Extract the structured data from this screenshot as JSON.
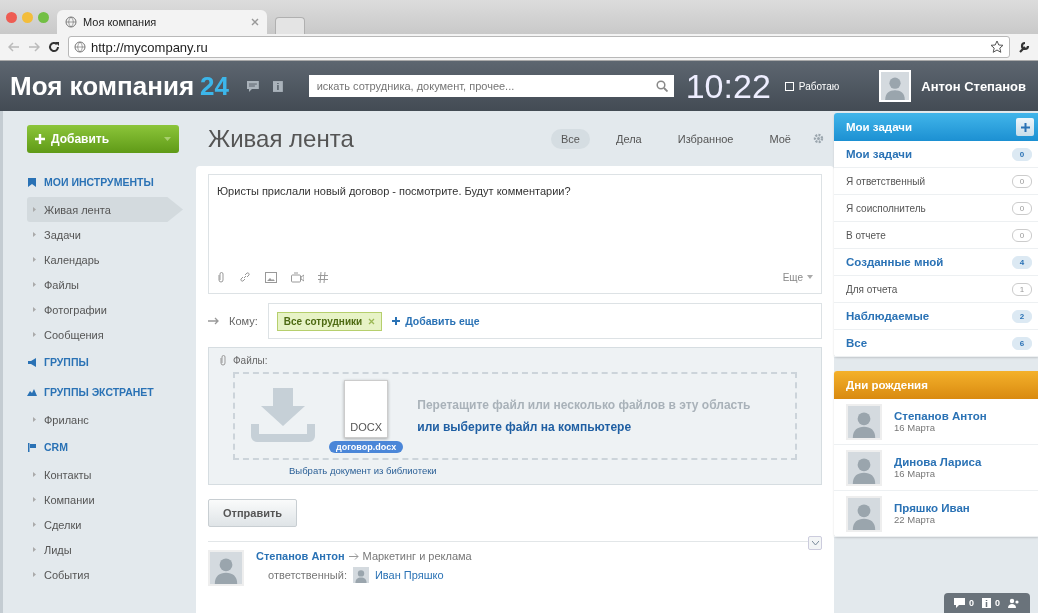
{
  "browser": {
    "tab_title": "Моя компания",
    "url": "http://mycompany.ru"
  },
  "header": {
    "logo": "Моя компания",
    "logo_number": "24",
    "search": {
      "placeholder": "искать сотрудника, документ, прочее..."
    },
    "clock": "10:22",
    "status": {
      "label": "Работаю",
      "checked": false
    },
    "user": "Антон Степанов"
  },
  "sidebar": {
    "add_button": "Добавить",
    "sections": [
      {
        "title": "МОИ ИНСТРУМЕНТЫ",
        "items": [
          {
            "label": "Живая лента",
            "selected": true
          },
          {
            "label": "Задачи",
            "selected": false
          },
          {
            "label": "Календарь",
            "selected": false
          },
          {
            "label": "Файлы",
            "selected": false
          },
          {
            "label": "Фотографии",
            "selected": false
          },
          {
            "label": "Сообщения",
            "selected": false
          }
        ]
      },
      {
        "title": "ГРУППЫ"
      },
      {
        "title": "ГРУППЫ ЭКСТРАНЕТ",
        "items": [
          {
            "label": "Фриланс",
            "selected": false
          }
        ]
      },
      {
        "title": "CRM",
        "items": [
          {
            "label": "Контакты",
            "selected": false
          },
          {
            "label": "Компании",
            "selected": false
          },
          {
            "label": "Сделки",
            "selected": false
          },
          {
            "label": "Лиды",
            "selected": false
          },
          {
            "label": "События",
            "selected": false
          }
        ]
      }
    ]
  },
  "feed": {
    "title": "Живая лента",
    "filters": [
      {
        "label": "Все",
        "selected": true
      },
      {
        "label": "Дела",
        "selected": false
      },
      {
        "label": "Избранное",
        "selected": false
      },
      {
        "label": "Моё",
        "selected": false
      }
    ],
    "composer": {
      "text": "Юристы прислали новый договор - посмотрите. Будут комментарии?",
      "more": "Еще",
      "to_label": "Кому:",
      "recipients": [
        "Все сотрудники"
      ],
      "add_more": "Добавить еще",
      "files_label": "Файлы:",
      "drop_text": "Перетащите файл или несколько файлов в эту область",
      "drop_link": "или выберите файл на компьютере",
      "library_link": "Выбрать документ из библиотеки",
      "dragged_file": {
        "type": "DOCX",
        "name": "договор.docx"
      },
      "send": "Отправить"
    },
    "post": {
      "author": "Степанов Антон",
      "group": "Маркетинг и реклама",
      "responsible_label": "ответственный:",
      "responsible": "Иван Пряшко"
    }
  },
  "tasks": {
    "title": "Мои задачи",
    "items": [
      {
        "label": "Мои задачи",
        "count": "0",
        "highlighted": true
      },
      {
        "label": "Я ответственный",
        "count": "0",
        "highlighted": false
      },
      {
        "label": "Я соисполнитель",
        "count": "0",
        "highlighted": false
      },
      {
        "label": "В отчете",
        "count": "0",
        "highlighted": false
      },
      {
        "label": "Созданные мной",
        "count": "4",
        "highlighted": true
      },
      {
        "label": "Для отчета",
        "count": "1",
        "highlighted": false
      },
      {
        "label": "Наблюдаемые",
        "count": "2",
        "highlighted": true
      },
      {
        "label": "Все",
        "count": "6",
        "highlighted": true
      }
    ]
  },
  "birthdays": {
    "title": "Дни рождения",
    "people": [
      {
        "name": "Степанов Антон",
        "date": "16 Марта"
      },
      {
        "name": "Динова Лариса",
        "date": "16 Марта"
      },
      {
        "name": "Пряшко Иван",
        "date": "22 Марта"
      }
    ]
  },
  "toolbar": {
    "messages": "0",
    "notifications": "0"
  }
}
